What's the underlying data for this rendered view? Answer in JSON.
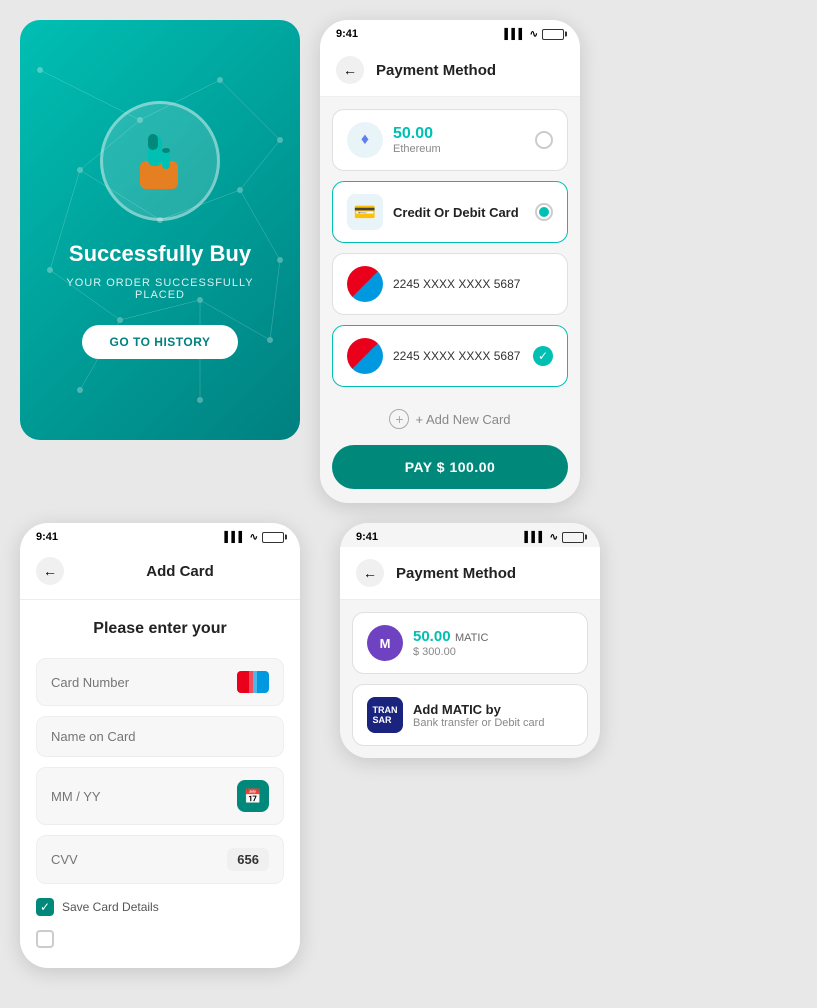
{
  "screen1": {
    "title": "Successfully Buy",
    "subtitle": "YOUR ORDER SUCCESSFULLY PLACED",
    "button": "GO TO HISTORY",
    "icon": "👍"
  },
  "screen2": {
    "statusTime": "9:41",
    "headerTitle": "Payment Method",
    "ethereum": {
      "amount": "50.00",
      "name": "Ethereum"
    },
    "creditCard": {
      "label": "Credit Or Debit Card"
    },
    "cards": [
      {
        "number": "2245 XXXX XXXX 5687",
        "selected": false
      },
      {
        "number": "2245 XXXX XXXX 5687",
        "selected": true
      }
    ],
    "addCard": "+ Add New Card",
    "payButton": "PAY $ 100.00"
  },
  "screen3": {
    "statusTime": "9:41",
    "headerTitle": "Add Card",
    "subtitle": "Please enter your",
    "cardNumber": {
      "placeholder": "Card Number"
    },
    "nameOnCard": {
      "placeholder": "Name on Card"
    },
    "expiry": {
      "placeholder": "MM / YY"
    },
    "cvv": {
      "placeholder": "CVV",
      "value": "656"
    },
    "saveCard": "Save Card Details"
  },
  "screen4": {
    "statusTime": "9:41",
    "headerTitle": "Payment Method",
    "matic": {
      "amount": "50.00",
      "currency": "MATIC",
      "usd": "$ 300.00"
    },
    "bankTransfer": {
      "title": "Add MATIC by",
      "subtitle": "Bank transfer or Debit card"
    }
  }
}
